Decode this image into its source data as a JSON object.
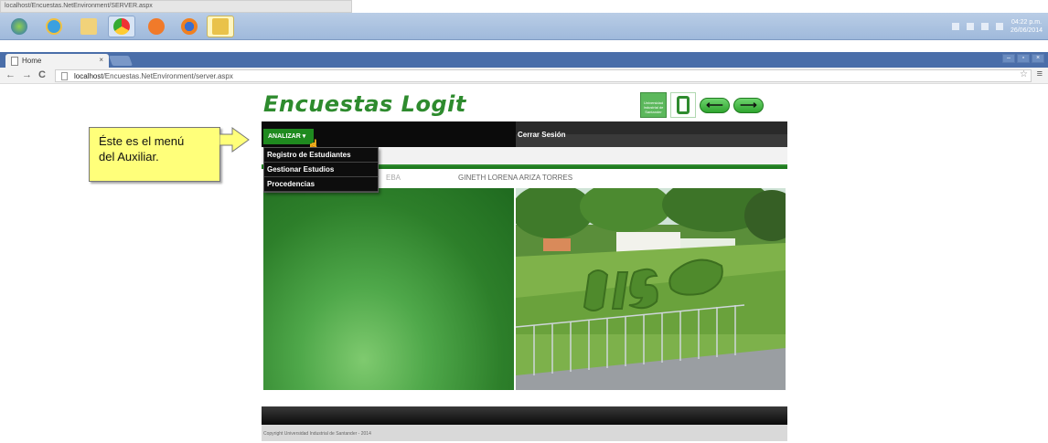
{
  "top_url": "localhost/Encuestas.NetEnvironment/SERVER.aspx",
  "taskbar": {
    "apps": [
      "windows-start-icon",
      "internet-explorer-icon",
      "file-explorer-icon",
      "chrome-icon",
      "media-player-icon",
      "firefox-icon",
      "app-icon"
    ],
    "clock_time": "04:22 p.m.",
    "clock_date": "26/06/2014"
  },
  "browser": {
    "tab_title": "Home",
    "tab_close": "×",
    "url_host": "localhost",
    "url_path": "/Encuestas.NetEnvironment/server.aspx"
  },
  "page": {
    "title": "Encuestas Logit",
    "logo_text": "Universidad Industrial de Santander",
    "menu": {
      "analizar": "ANALIZAR",
      "cerrar_sesion": "Cerrar Sesión",
      "dropdown_items": [
        "Registro de Estudiantes",
        "Gestionar Estudios",
        "Procedencias"
      ]
    },
    "user_row": {
      "faded_text": "EBA",
      "user_name": "GINETH LORENA ARIZA TORRES"
    },
    "footer": "Copyright Universidad Industrial de Santander - 2014"
  },
  "callout": {
    "line1": "Éste es el menú",
    "line2": "del Auxiliar."
  },
  "colors": {
    "brand_green": "#2e8b2e",
    "callout_yellow": "#ffff7a",
    "menu_black": "#0b0b0b"
  }
}
